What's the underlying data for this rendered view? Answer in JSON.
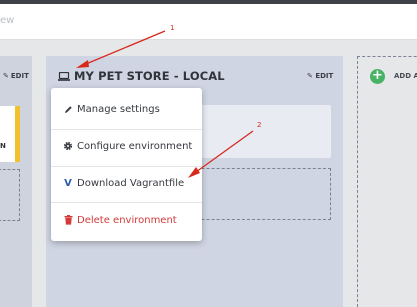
{
  "header": {
    "partial_text": "ew"
  },
  "left_column": {
    "edit_label": "EDIT",
    "card_text": "N"
  },
  "environment": {
    "title": "MY PET STORE - LOCAL",
    "edit_label": "EDIT"
  },
  "right_column": {
    "add_label": "ADD A"
  },
  "menu": {
    "items": [
      {
        "label": "Manage settings",
        "icon": "pencil-icon"
      },
      {
        "label": "Configure environment",
        "icon": "gear-icon"
      },
      {
        "label": "Download Vagrantfile",
        "icon": "vagrant-icon",
        "glyph": "V"
      },
      {
        "label": "Delete environment",
        "icon": "trash-icon"
      }
    ]
  },
  "annotations": {
    "label_1": "1",
    "label_2": "2"
  },
  "colors": {
    "accent_yellow": "#f2c12e",
    "add_green": "#48b265",
    "danger_red": "#d33a3a",
    "annotation_red": "#d62a1c"
  }
}
